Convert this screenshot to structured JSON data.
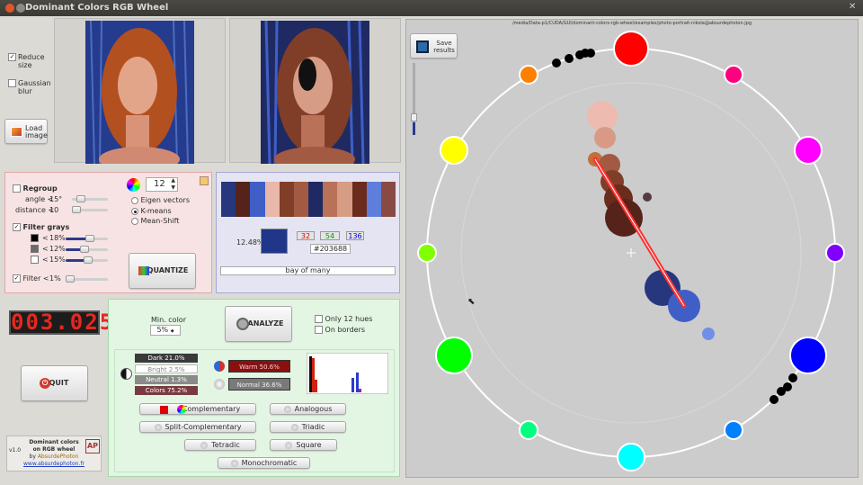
{
  "window": {
    "title": "Dominant Colors RGB Wheel"
  },
  "left": {
    "reduce_size": "Reduce size",
    "gaussian_blur": "Gaussian blur",
    "load_image": "Load image"
  },
  "regroup": {
    "label": "Regroup",
    "angle_label": "angle <",
    "angle_value": "15°",
    "distance_label": "distance <",
    "distance_value": "10"
  },
  "filter_grays": {
    "label": "Filter grays",
    "rows": [
      {
        "op": "<",
        "value": "18%",
        "swatch": "#000000"
      },
      {
        "op": "<",
        "value": "12%",
        "swatch": "#6b6b6b"
      },
      {
        "op": "<",
        "value": "15%",
        "swatch": "#ffffff"
      }
    ]
  },
  "filter": {
    "label": "Filter <",
    "value": "1%"
  },
  "quantize": {
    "count": "12",
    "methods": [
      "Eigen vectors",
      "K-means",
      "Mean-Shift"
    ],
    "selected": 1,
    "button": "QUANTIZE"
  },
  "palette": {
    "swatches": [
      "#26377e",
      "#55231a",
      "#3f5fc7",
      "#e9b8ab",
      "#803e28",
      "#a35a42",
      "#1f2a63",
      "#b97157",
      "#d79c85",
      "#6b2b1d",
      "#5f7edc",
      "#8a4a44"
    ],
    "percent": "12.48%",
    "selected_color": "#203688",
    "r": "32",
    "g": "54",
    "b": "136",
    "hex": "#203688",
    "name": "bay of many"
  },
  "counter": {
    "value": "003.025"
  },
  "quit": {
    "label": "QUIT"
  },
  "about": {
    "version": "v1.0",
    "title_line1": "Dominant colors",
    "title_line2": "on RGB wheel",
    "by": "by",
    "author": "AbsurdePhoton",
    "url": "www.absurdephoton.fr",
    "logo_text": "AP"
  },
  "analyze": {
    "min_color_label": "Min. color",
    "min_color_value": "5%",
    "button": "ANALYZE",
    "only_hues": "Only 12 hues",
    "on_borders": "On borders"
  },
  "stats": {
    "dark": "Dark 21.0%",
    "bright": "Bright 2.5%",
    "neutral": "Neutral 1.3%",
    "colors": "Colors 75.2%",
    "warm": "Warm 50.6%",
    "normal": "Normal 36.6%"
  },
  "harmonies": {
    "complementary": "Complementary",
    "analogous": "Analogous",
    "split_complementary": "Split-Complementary",
    "triadic": "Triadic",
    "tetradic": "Tetradic",
    "square": "Square",
    "monochromatic": "Monochromatic"
  },
  "wheel": {
    "path": "/media/Data-p1/CUDA/GUI/dominant-colors-rgb-wheel/examples/photo-portrait-nikola@absurdephoton.jpg",
    "save_results": "Save results"
  },
  "colors": {
    "accent": "#2b3a8c",
    "lcd": "#e5281f",
    "regroup_panel": "#f7e3e3",
    "palette_panel": "#e4e4f3",
    "analyze_panel": "#e3f5e3"
  }
}
